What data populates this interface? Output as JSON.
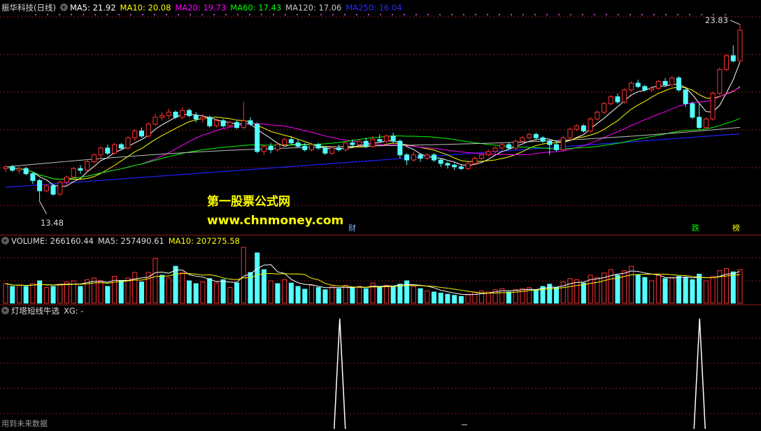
{
  "price_header": {
    "title": "振华科技(日线)",
    "ma5": "MA5: 21.92",
    "ma10": "MA10: 20.08",
    "ma20": "MA20: 19.73",
    "ma60": "MA60: 17.43",
    "ma120": "MA120: 17.06",
    "ma250": "MA250: 16.04"
  },
  "price_annotations": {
    "high": "23.83",
    "low": "13.48",
    "tag_cai": "财",
    "tag_die": "跌",
    "tag_bang": "榜"
  },
  "watermark": {
    "line1": "第一股票公式网",
    "line2": "www.chnmoney.com"
  },
  "volume_header": {
    "volume": "VOLUME: 266160.44",
    "ma5": "MA5: 257490.61",
    "ma10": "MA10: 207275.58"
  },
  "indicator_header": {
    "title": "灯塔短线牛选",
    "xg": "XG: -"
  },
  "footer": {
    "note": "用到未来数据"
  },
  "colors": {
    "ma5": "#ffffff",
    "ma10": "#ffff00",
    "ma20": "#ff00ff",
    "ma60": "#00ff00",
    "ma120": "#c0c0c0",
    "ma250": "#2020ff",
    "up": "#ff3232",
    "down": "#54ffff",
    "grid": "#8b1a1a"
  },
  "chart_data": {
    "type": "candlestick",
    "price_range": [
      13.48,
      23.83
    ],
    "candles": [
      [
        15.4,
        15.5,
        15.2,
        15.6
      ],
      [
        15.5,
        15.3,
        15.2,
        15.6
      ],
      [
        15.3,
        15.4,
        15.1,
        15.5
      ],
      [
        15.4,
        15.1,
        15.0,
        15.5
      ],
      [
        15.1,
        14.7,
        14.5,
        15.2
      ],
      [
        14.7,
        14.1,
        13.48,
        14.8
      ],
      [
        14.1,
        14.4,
        14.0,
        14.5
      ],
      [
        14.4,
        13.9,
        13.8,
        14.5
      ],
      [
        13.9,
        14.6,
        13.8,
        14.7
      ],
      [
        14.6,
        14.9,
        14.4,
        15.0
      ],
      [
        14.9,
        15.4,
        14.8,
        15.5
      ],
      [
        15.4,
        15.3,
        15.1,
        15.6
      ],
      [
        15.3,
        15.8,
        15.2,
        15.9
      ],
      [
        15.8,
        16.2,
        15.7,
        16.3
      ],
      [
        16.2,
        16.6,
        16.0,
        16.7
      ],
      [
        16.6,
        16.3,
        16.2,
        16.8
      ],
      [
        16.3,
        16.8,
        16.2,
        16.9
      ],
      [
        16.8,
        16.6,
        16.5,
        16.9
      ],
      [
        16.6,
        17.2,
        16.5,
        17.3
      ],
      [
        17.2,
        17.6,
        17.0,
        17.7
      ],
      [
        17.6,
        17.3,
        17.2,
        17.8
      ],
      [
        17.3,
        18.0,
        17.2,
        18.1
      ],
      [
        18.0,
        18.4,
        17.9,
        18.6
      ],
      [
        18.4,
        18.5,
        18.2,
        18.7
      ],
      [
        18.5,
        18.7,
        18.3,
        18.9
      ],
      [
        18.7,
        18.4,
        18.3,
        18.8
      ],
      [
        18.4,
        18.8,
        18.3,
        19.0
      ],
      [
        18.8,
        18.5,
        18.4,
        18.9
      ],
      [
        18.5,
        18.3,
        18.1,
        18.7
      ],
      [
        18.3,
        18.4,
        18.1,
        18.6
      ],
      [
        18.4,
        17.9,
        17.8,
        18.5
      ],
      [
        17.9,
        18.2,
        17.8,
        18.3
      ],
      [
        18.2,
        17.9,
        17.8,
        18.3
      ],
      [
        17.9,
        18.1,
        17.8,
        18.2
      ],
      [
        18.1,
        17.8,
        17.7,
        18.2
      ],
      [
        17.8,
        18.2,
        17.7,
        19.3
      ],
      [
        18.2,
        18.0,
        17.9,
        18.4
      ],
      [
        18.0,
        16.4,
        16.3,
        18.1
      ],
      [
        16.4,
        16.7,
        16.2,
        16.8
      ],
      [
        16.7,
        16.5,
        16.3,
        16.9
      ],
      [
        16.5,
        16.8,
        16.4,
        16.9
      ],
      [
        16.8,
        17.1,
        16.7,
        17.2
      ],
      [
        17.1,
        16.9,
        16.8,
        17.3
      ],
      [
        16.9,
        16.7,
        16.6,
        17.1
      ],
      [
        16.7,
        16.5,
        16.4,
        16.9
      ],
      [
        16.5,
        16.8,
        16.4,
        16.9
      ],
      [
        16.8,
        16.6,
        16.5,
        16.9
      ],
      [
        16.6,
        16.3,
        16.2,
        16.7
      ],
      [
        16.3,
        16.6,
        16.2,
        16.7
      ],
      [
        16.6,
        16.5,
        16.4,
        16.8
      ],
      [
        16.5,
        16.9,
        16.4,
        17.0
      ],
      [
        16.9,
        16.8,
        16.7,
        17.1
      ],
      [
        16.8,
        17.0,
        16.7,
        17.1
      ],
      [
        17.0,
        16.7,
        16.6,
        17.2
      ],
      [
        16.7,
        17.1,
        16.6,
        17.3
      ],
      [
        17.1,
        17.0,
        16.9,
        17.4
      ],
      [
        17.0,
        17.3,
        16.9,
        17.4
      ],
      [
        17.3,
        17.0,
        16.9,
        17.5
      ],
      [
        17.0,
        16.2,
        16.0,
        17.1
      ],
      [
        16.2,
        15.9,
        15.6,
        16.3
      ],
      [
        15.9,
        16.2,
        15.8,
        16.4
      ],
      [
        16.2,
        16.0,
        15.8,
        16.3
      ],
      [
        16.0,
        16.2,
        15.9,
        16.3
      ],
      [
        16.2,
        15.9,
        15.8,
        16.3
      ],
      [
        15.9,
        15.7,
        15.5,
        16.0
      ],
      [
        15.7,
        15.6,
        15.4,
        15.8
      ],
      [
        15.6,
        15.5,
        15.3,
        15.7
      ],
      [
        15.5,
        15.4,
        15.3,
        15.6
      ],
      [
        15.4,
        15.7,
        15.3,
        15.8
      ],
      [
        15.7,
        16.0,
        15.6,
        16.1
      ],
      [
        16.0,
        16.2,
        15.9,
        16.3
      ],
      [
        16.2,
        16.4,
        16.1,
        16.5
      ],
      [
        16.4,
        16.6,
        16.3,
        16.7
      ],
      [
        16.6,
        16.8,
        16.5,
        16.9
      ],
      [
        16.8,
        16.6,
        16.5,
        16.9
      ],
      [
        16.6,
        17.0,
        16.5,
        17.1
      ],
      [
        17.0,
        17.2,
        16.9,
        17.3
      ],
      [
        17.2,
        17.4,
        17.1,
        17.5
      ],
      [
        17.4,
        17.2,
        17.1,
        17.5
      ],
      [
        17.2,
        17.0,
        16.9,
        17.3
      ],
      [
        17.0,
        16.8,
        16.2,
        17.1
      ],
      [
        16.8,
        16.5,
        16.4,
        16.9
      ],
      [
        16.5,
        17.2,
        16.4,
        17.3
      ],
      [
        17.2,
        17.7,
        17.1,
        17.8
      ],
      [
        17.7,
        17.9,
        17.6,
        18.0
      ],
      [
        17.9,
        17.6,
        17.5,
        18.0
      ],
      [
        17.6,
        18.3,
        17.5,
        18.4
      ],
      [
        18.3,
        18.7,
        18.2,
        18.8
      ],
      [
        18.7,
        19.2,
        18.6,
        19.3
      ],
      [
        19.2,
        19.6,
        19.1,
        19.7
      ],
      [
        19.6,
        19.3,
        19.2,
        19.8
      ],
      [
        19.3,
        20.0,
        19.2,
        20.1
      ],
      [
        20.0,
        20.4,
        19.9,
        20.5
      ],
      [
        20.4,
        20.2,
        20.1,
        20.6
      ],
      [
        20.2,
        20.0,
        19.9,
        20.3
      ],
      [
        20.0,
        20.1,
        19.9,
        20.2
      ],
      [
        20.1,
        20.5,
        20.0,
        20.6
      ],
      [
        20.5,
        20.3,
        20.2,
        20.7
      ],
      [
        20.3,
        20.7,
        20.2,
        20.8
      ],
      [
        20.7,
        20.0,
        19.9,
        20.8
      ],
      [
        20.0,
        19.2,
        19.0,
        20.1
      ],
      [
        19.2,
        18.4,
        18.3,
        19.3
      ],
      [
        18.4,
        17.8,
        17.7,
        19.2
      ],
      [
        17.8,
        18.3,
        17.7,
        18.4
      ],
      [
        18.3,
        19.8,
        18.2,
        19.9
      ],
      [
        19.8,
        21.2,
        19.7,
        21.3
      ],
      [
        21.2,
        22.0,
        21.1,
        22.1
      ],
      [
        22.0,
        21.7,
        21.6,
        22.6
      ],
      [
        21.7,
        23.5,
        21.6,
        23.83
      ]
    ],
    "ma_series": {
      "MA5": 21.92,
      "MA10": 20.08,
      "MA20": 19.73,
      "MA60": 17.43,
      "MA120": 17.06,
      "MA250": 16.04
    },
    "volume": [
      [
        0.35,
        0
      ],
      [
        0.3,
        1
      ],
      [
        0.32,
        0
      ],
      [
        0.3,
        1
      ],
      [
        0.35,
        0
      ],
      [
        0.4,
        1
      ],
      [
        0.28,
        0
      ],
      [
        0.3,
        1
      ],
      [
        0.34,
        0
      ],
      [
        0.38,
        0
      ],
      [
        0.4,
        0
      ],
      [
        0.3,
        1
      ],
      [
        0.42,
        0
      ],
      [
        0.45,
        0
      ],
      [
        0.4,
        0
      ],
      [
        0.3,
        1
      ],
      [
        0.48,
        0
      ],
      [
        0.4,
        1
      ],
      [
        0.45,
        0
      ],
      [
        0.55,
        0
      ],
      [
        0.38,
        1
      ],
      [
        0.55,
        0
      ],
      [
        0.8,
        0
      ],
      [
        0.5,
        1
      ],
      [
        0.45,
        0
      ],
      [
        0.66,
        1
      ],
      [
        0.55,
        0
      ],
      [
        0.4,
        1
      ],
      [
        0.35,
        1
      ],
      [
        0.38,
        0
      ],
      [
        0.44,
        1
      ],
      [
        0.36,
        0
      ],
      [
        0.42,
        1
      ],
      [
        0.28,
        0
      ],
      [
        0.36,
        1
      ],
      [
        1.0,
        0
      ],
      [
        0.55,
        1
      ],
      [
        0.9,
        1
      ],
      [
        0.6,
        1
      ],
      [
        0.4,
        0
      ],
      [
        0.35,
        1
      ],
      [
        0.42,
        0
      ],
      [
        0.36,
        1
      ],
      [
        0.3,
        1
      ],
      [
        0.25,
        1
      ],
      [
        0.32,
        0
      ],
      [
        0.28,
        1
      ],
      [
        0.24,
        1
      ],
      [
        0.3,
        0
      ],
      [
        0.26,
        1
      ],
      [
        0.32,
        0
      ],
      [
        0.28,
        1
      ],
      [
        0.3,
        0
      ],
      [
        0.26,
        1
      ],
      [
        0.36,
        0
      ],
      [
        0.3,
        1
      ],
      [
        0.32,
        0
      ],
      [
        0.3,
        1
      ],
      [
        0.34,
        1
      ],
      [
        0.4,
        1
      ],
      [
        0.3,
        0
      ],
      [
        0.26,
        1
      ],
      [
        0.22,
        0
      ],
      [
        0.2,
        1
      ],
      [
        0.18,
        1
      ],
      [
        0.16,
        1
      ],
      [
        0.14,
        1
      ],
      [
        0.12,
        1
      ],
      [
        0.16,
        0
      ],
      [
        0.2,
        0
      ],
      [
        0.22,
        0
      ],
      [
        0.2,
        0
      ],
      [
        0.24,
        0
      ],
      [
        0.26,
        0
      ],
      [
        0.2,
        1
      ],
      [
        0.24,
        0
      ],
      [
        0.26,
        0
      ],
      [
        0.28,
        0
      ],
      [
        0.24,
        1
      ],
      [
        0.3,
        1
      ],
      [
        0.34,
        1
      ],
      [
        0.28,
        1
      ],
      [
        0.38,
        0
      ],
      [
        0.44,
        0
      ],
      [
        0.42,
        0
      ],
      [
        0.36,
        1
      ],
      [
        0.5,
        0
      ],
      [
        0.46,
        0
      ],
      [
        0.54,
        0
      ],
      [
        0.6,
        0
      ],
      [
        0.5,
        1
      ],
      [
        0.58,
        0
      ],
      [
        0.66,
        0
      ],
      [
        0.5,
        1
      ],
      [
        0.46,
        1
      ],
      [
        0.4,
        0
      ],
      [
        0.5,
        0
      ],
      [
        0.44,
        1
      ],
      [
        0.46,
        0
      ],
      [
        0.48,
        1
      ],
      [
        0.46,
        1
      ],
      [
        0.42,
        1
      ],
      [
        0.52,
        1
      ],
      [
        0.4,
        0
      ],
      [
        0.48,
        0
      ],
      [
        0.58,
        0
      ],
      [
        0.62,
        0
      ],
      [
        0.56,
        1
      ],
      [
        0.6,
        0
      ]
    ],
    "indicator_xg_spikes": [
      0.455,
      0.945
    ]
  }
}
